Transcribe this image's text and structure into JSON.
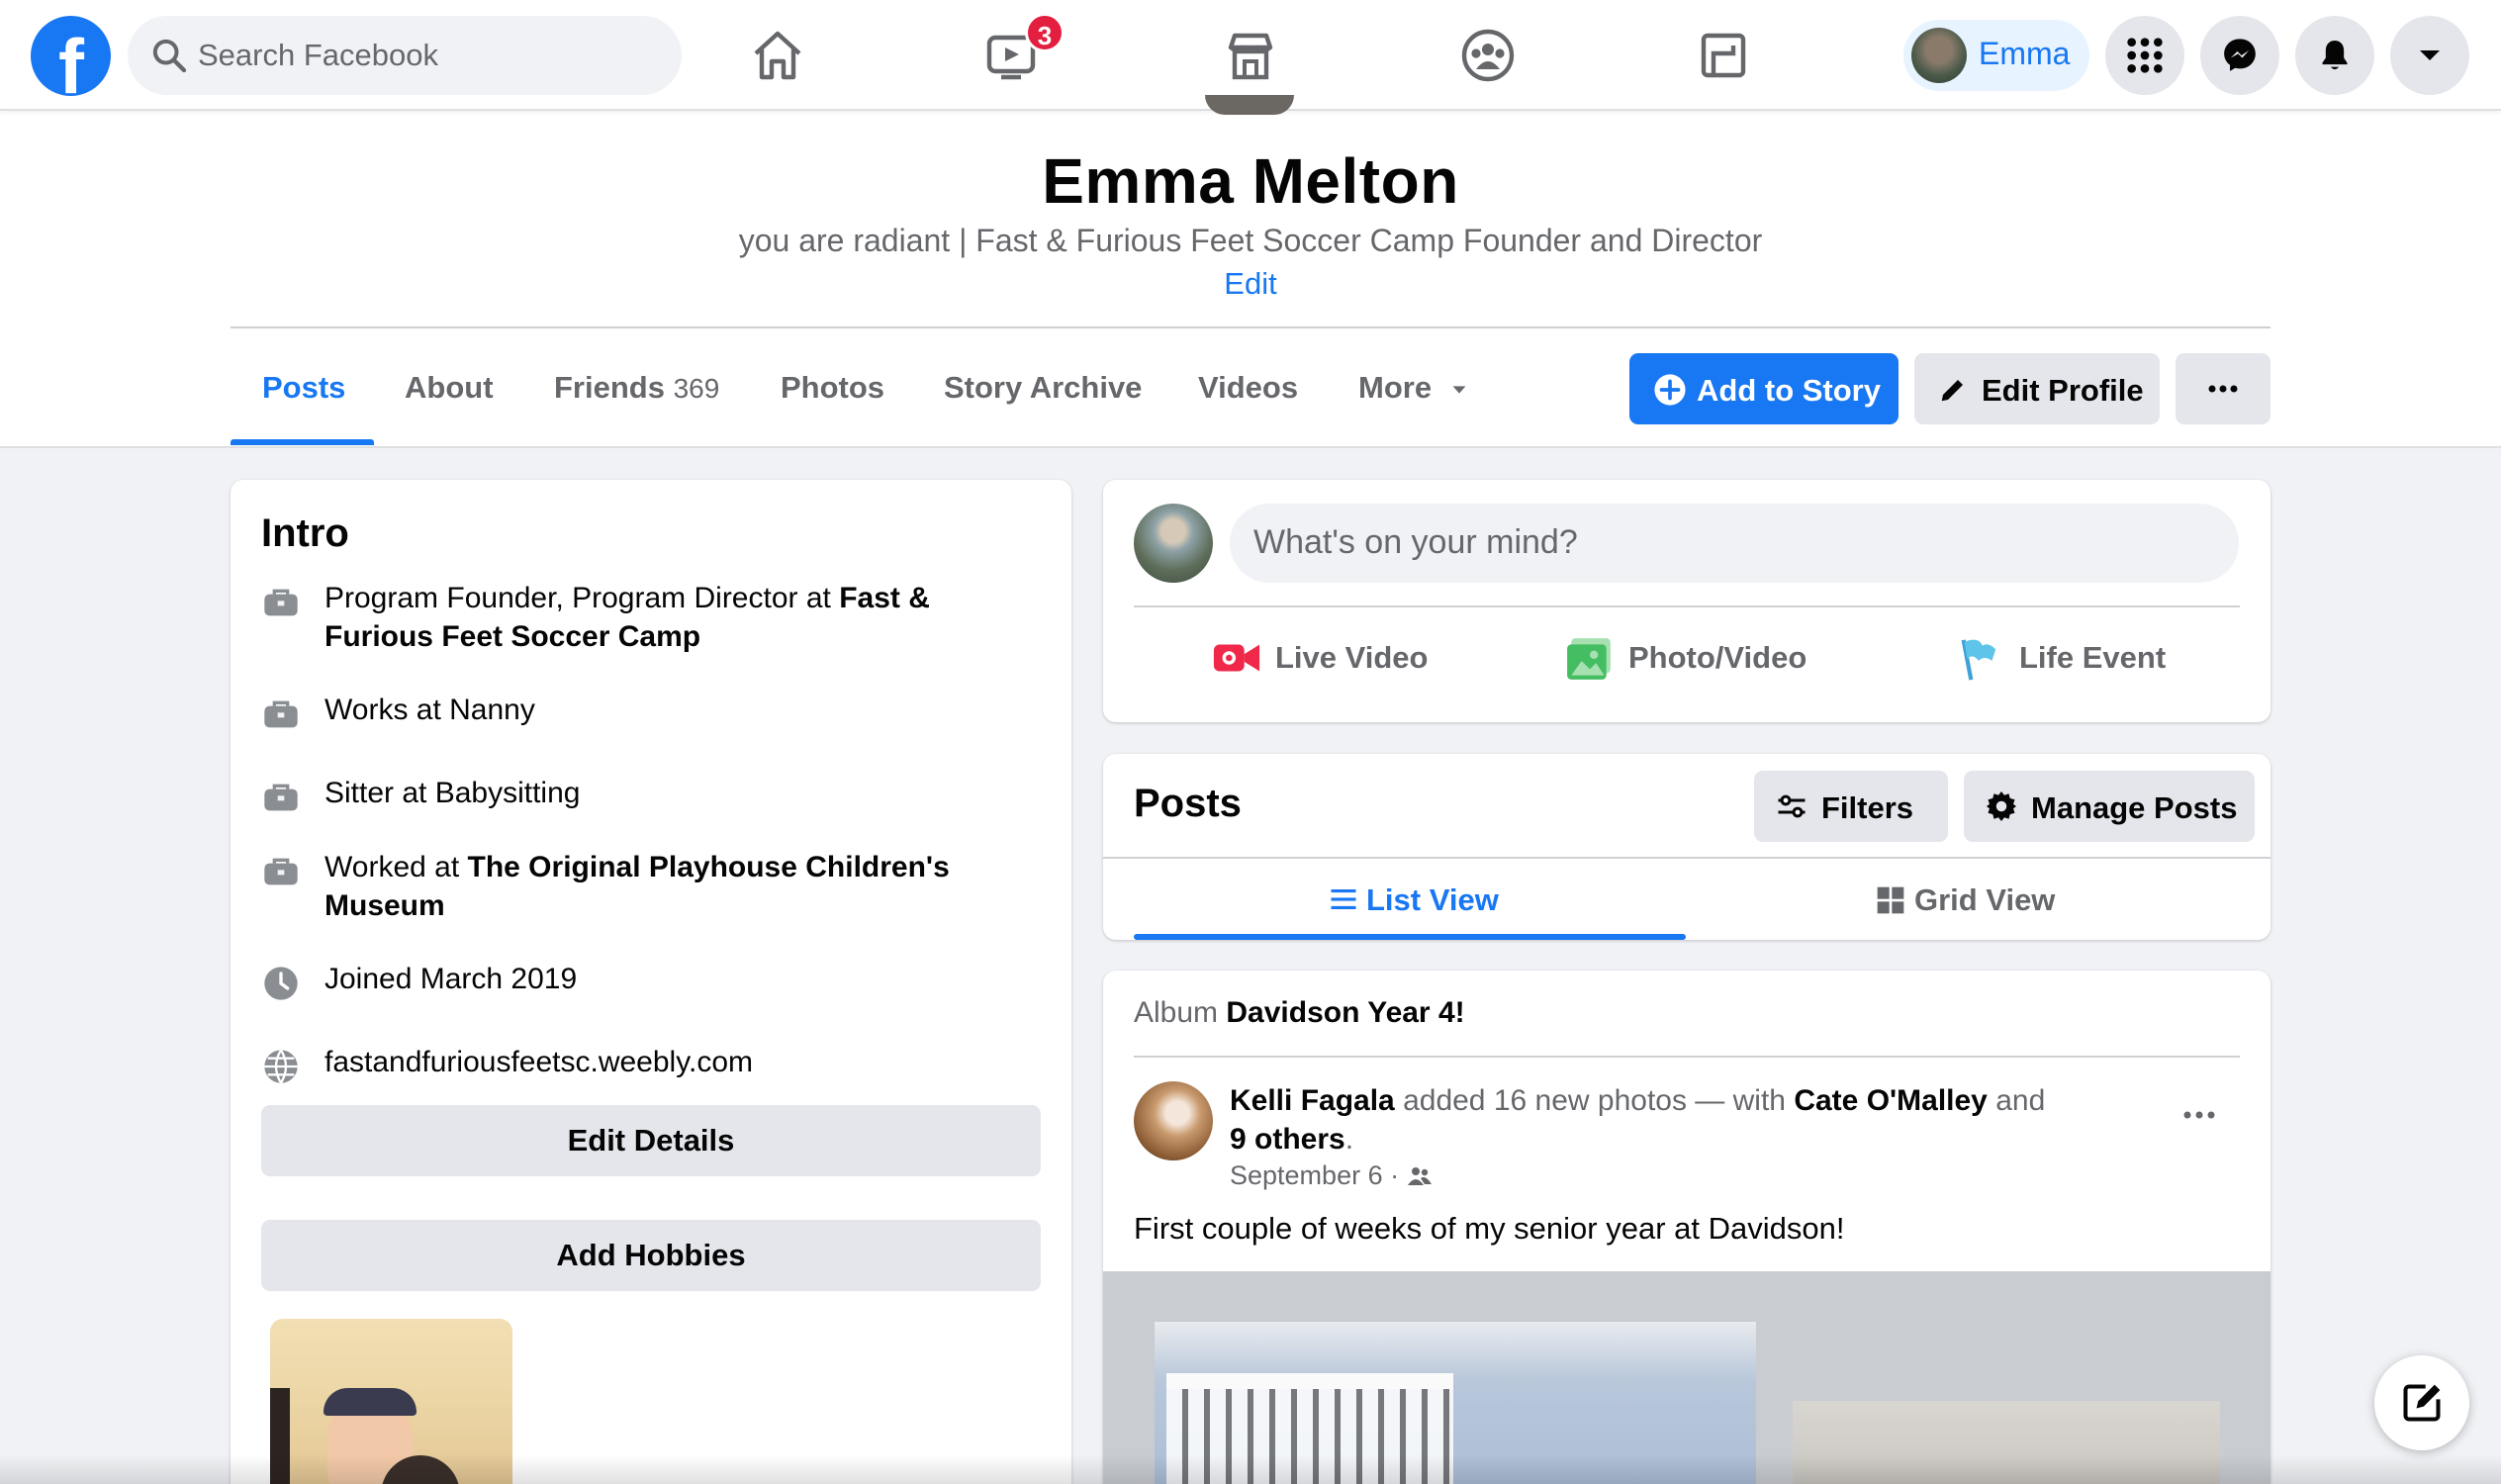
{
  "nav": {
    "search_placeholder": "Search Facebook",
    "watch_badge": "3",
    "user_name": "Emma",
    "brand_color": "#1877f2"
  },
  "profile": {
    "name": "Emma Melton",
    "bio": "you are radiant | Fast & Furious Feet Soccer Camp Founder and Director",
    "bio_edit": "Edit"
  },
  "tabs": [
    {
      "label": "Posts",
      "active": true
    },
    {
      "label": "About"
    },
    {
      "label": "Friends",
      "count": "369"
    },
    {
      "label": "Photos"
    },
    {
      "label": "Story Archive"
    },
    {
      "label": "Videos"
    },
    {
      "label": "More"
    }
  ],
  "actions": {
    "add_story": "Add to Story",
    "edit_profile": "Edit Profile",
    "more": "···"
  },
  "intro": {
    "title": "Intro",
    "items": [
      {
        "icon": "briefcase-icon",
        "prefix": "Program Founder, Program Director at ",
        "bold": "Fast & Furious Feet Soccer Camp"
      },
      {
        "icon": "briefcase-icon",
        "prefix": "Works at Nanny",
        "bold": ""
      },
      {
        "icon": "briefcase-icon",
        "prefix": "Sitter at Babysitting",
        "bold": ""
      },
      {
        "icon": "briefcase-icon",
        "prefix": "Worked at ",
        "bold": "The Original Playhouse Children's Museum"
      },
      {
        "icon": "clock-icon",
        "prefix": "Joined March 2019",
        "bold": ""
      },
      {
        "icon": "globe-icon",
        "link": "fastandfuriousfeetsc.weebly.com"
      }
    ],
    "edit_details": "Edit Details",
    "add_hobbies": "Add Hobbies"
  },
  "composer": {
    "placeholder": "What's on your mind?",
    "live_video": "Live Video",
    "photo_video": "Photo/Video",
    "life_event": "Life Event"
  },
  "posts_panel": {
    "title": "Posts",
    "filters": "Filters",
    "manage": "Manage Posts",
    "list_view": "List View",
    "grid_view": "Grid View"
  },
  "feed_post": {
    "album_label": "Album",
    "album_name": "Davidson Year 4!",
    "author": "Kelli Fagala",
    "action": " added 16 new photos — with ",
    "tagged": "Cate O'Malley",
    "and": " and",
    "others": "9 others",
    "period": ".",
    "date": "September 6 · ",
    "text": "First couple of weeks of my senior year at Davidson!"
  }
}
